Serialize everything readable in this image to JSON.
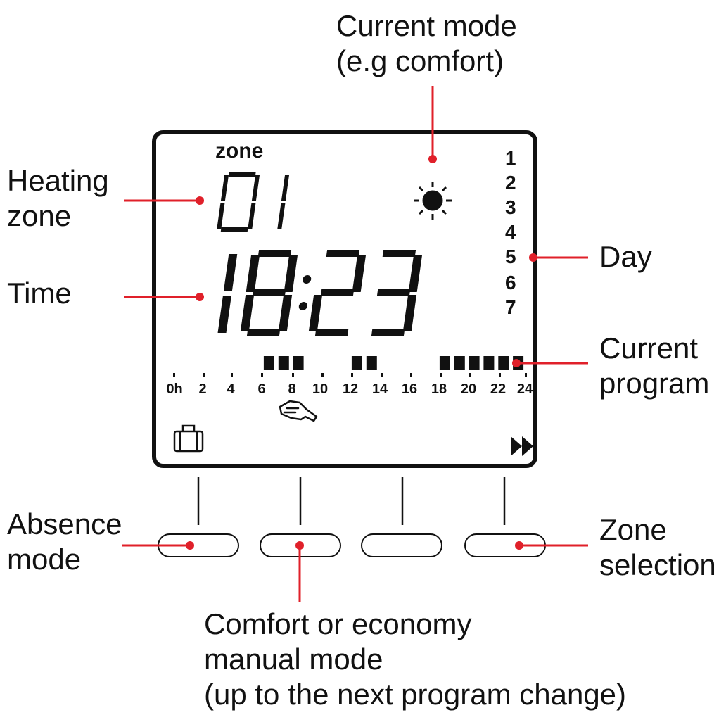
{
  "labels": {
    "current_mode": [
      "Current mode",
      "(e.g comfort)"
    ],
    "heating_zone": [
      "Heating",
      "zone"
    ],
    "time": "Time",
    "day": "Day",
    "current_program": [
      "Current",
      "program"
    ],
    "absence_mode": [
      "Absence",
      "mode"
    ],
    "zone_selection": [
      "Zone",
      "selection"
    ],
    "comfort_manual": [
      "Comfort or economy",
      "manual mode",
      "(up to the next program change)"
    ]
  },
  "display": {
    "zone_word": "zone",
    "zone_number": "01",
    "time": "18:23",
    "days": [
      "1",
      "2",
      "3",
      "4",
      "5",
      "6",
      "7"
    ],
    "hour_labels": [
      "0h",
      "2",
      "4",
      "6",
      "8",
      "10",
      "12",
      "14",
      "16",
      "18",
      "20",
      "22",
      "24"
    ],
    "mode_icon": "sun-icon",
    "manual_icon": "hand-icon",
    "absence_icon": "suitcase-icon",
    "zone_icon": "fast-forward-icon"
  },
  "program": {
    "comfort_hours": [
      6,
      7,
      8,
      12,
      13,
      18,
      19,
      20,
      21,
      22,
      23
    ]
  },
  "colors": {
    "accent": "#e0202a",
    "ink": "#111111"
  }
}
